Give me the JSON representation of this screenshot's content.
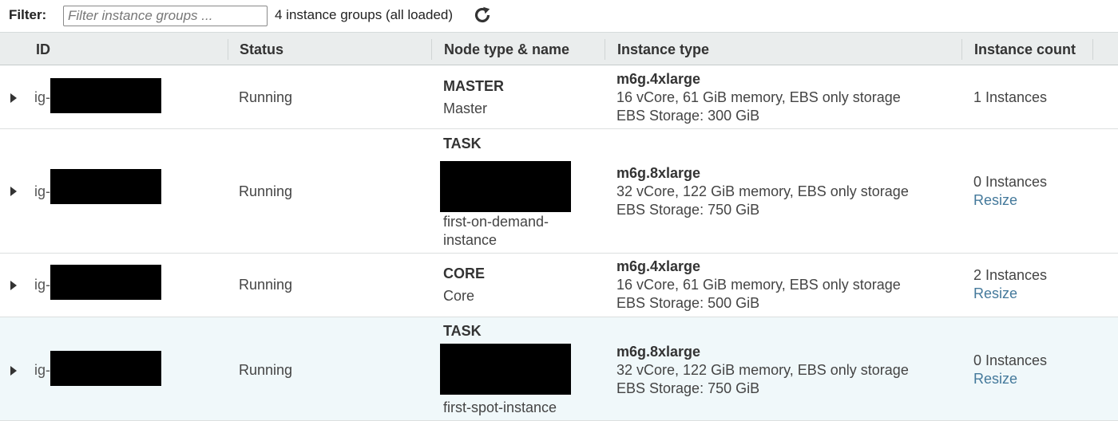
{
  "filter": {
    "label": "Filter:",
    "placeholder": "Filter instance groups ...",
    "value": "",
    "count_text": "4 instance groups (all loaded)",
    "refresh_icon": "refresh-icon"
  },
  "table": {
    "columns": [
      "ID",
      "Status",
      "Node type & name",
      "Instance type",
      "Instance count"
    ],
    "rows": [
      {
        "id_prefix": "ig-",
        "status": "Running",
        "node_type": "MASTER",
        "node_name": "Master",
        "instance_type": "m6g.4xlarge",
        "specs": "16 vCore, 61 GiB memory, EBS only storage",
        "storage": "EBS Storage:  300 GiB",
        "count": "1 Instances",
        "resize": ""
      },
      {
        "id_prefix": "ig-",
        "status": "Running",
        "node_type": "TASK",
        "node_name": "first-on-demand-instance",
        "node_name_lines": [
          "first-on-demand-",
          "instance"
        ],
        "instance_type": "m6g.8xlarge",
        "specs": "32 vCore, 122 GiB memory, EBS only storage",
        "storage": "EBS Storage:  750 GiB",
        "count": "0 Instances",
        "resize": "Resize"
      },
      {
        "id_prefix": "ig-",
        "status": "Running",
        "node_type": "CORE",
        "node_name": "Core",
        "instance_type": "m6g.4xlarge",
        "specs": "16 vCore, 61 GiB memory, EBS only storage",
        "storage": "EBS Storage:  500 GiB",
        "count": "2 Instances",
        "resize": "Resize"
      },
      {
        "id_prefix": "ig-",
        "status": "Running",
        "node_type": "TASK",
        "node_name": "first-spot-instance",
        "instance_type": "m6g.8xlarge",
        "specs": "32 vCore, 122 GiB memory, EBS only storage",
        "storage": "EBS Storage:  750 GiB",
        "count": "0 Instances",
        "resize": "Resize"
      }
    ]
  },
  "colors": {
    "header_bg": "#eaeded",
    "link": "#44799b",
    "selected_row_bg": "#f0f8fa",
    "redaction": "#000000"
  }
}
